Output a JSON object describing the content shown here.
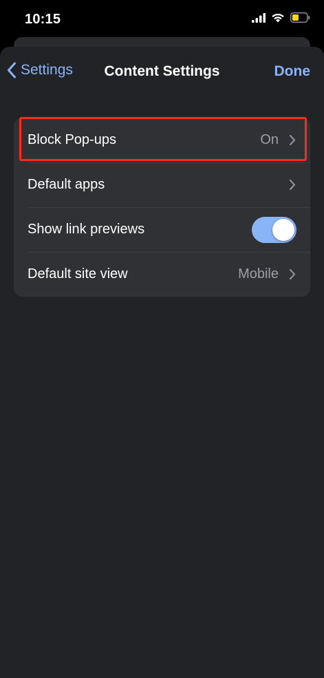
{
  "status_bar": {
    "time": "10:15"
  },
  "nav": {
    "back_label": "Settings",
    "title": "Content Settings",
    "done_label": "Done"
  },
  "settings": {
    "rows": [
      {
        "label": "Block Pop-ups",
        "value": "On"
      },
      {
        "label": "Default apps",
        "value": ""
      },
      {
        "label": "Show link previews",
        "toggle_on": true
      },
      {
        "label": "Default site view",
        "value": "Mobile"
      }
    ]
  },
  "colors": {
    "accent": "#8ab4f8",
    "highlight": "#ff2a1a",
    "sheet_bg": "#222326",
    "group_bg": "#303134"
  }
}
